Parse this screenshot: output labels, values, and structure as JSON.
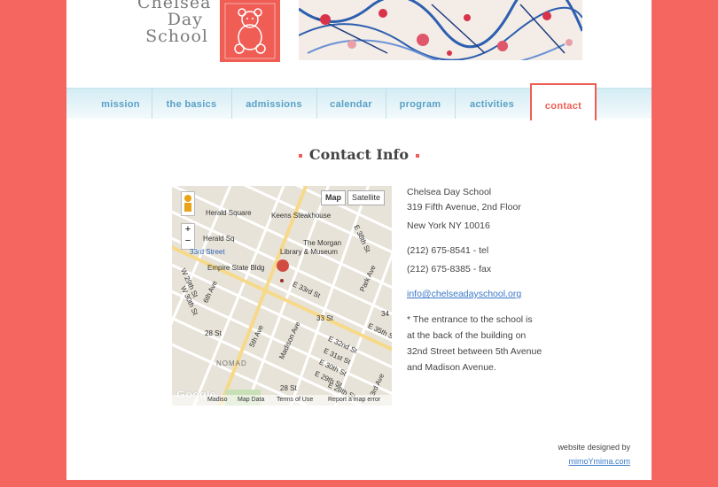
{
  "logo": {
    "line1": "Chelsea",
    "line2": "Day",
    "line3": "School"
  },
  "colors": {
    "accent": "#ef5d55",
    "nav_text": "#5aa0c6",
    "link": "#3a78c8",
    "background": "#f4665f"
  },
  "nav": {
    "items": [
      {
        "label": "mission"
      },
      {
        "label": "the basics"
      },
      {
        "label": "admissions"
      },
      {
        "label": "calendar"
      },
      {
        "label": "program"
      },
      {
        "label": "activities"
      },
      {
        "label": "contact",
        "active": true
      }
    ]
  },
  "page_title": "Contact Info",
  "map": {
    "map_button": "Map",
    "satellite_button": "Satellite",
    "zoom_in": "+",
    "zoom_out": "−",
    "labels": [
      "Herald Square",
      "Keens Steakhouse",
      "Herald Sq",
      "33rd Street",
      "The Morgan",
      "Library & Museum",
      "Empire State Bldg",
      "E 33rd St",
      "33 St",
      "28 St",
      "NOMAD",
      "28 St",
      "5th Ave",
      "Madison Ave",
      "Park Ave",
      "3rd Ave",
      "6th Ave",
      "W 29th St",
      "W 30th St",
      "E 38th St",
      "E 35th St",
      "E 32nd St",
      "E 31st St",
      "E 30th St",
      "E 29th St",
      "E 28th St",
      "34"
    ],
    "footer": {
      "data": "Map Data",
      "terms": "Terms of Use",
      "report": "Report a map error",
      "google": "Google",
      "street": "Madiso"
    }
  },
  "contact": {
    "name": "Chelsea Day School",
    "address1": "319 Fifth Avenue, 2nd Floor",
    "address2": "New York NY 10016",
    "tel": "(212) 675-8541 - tel",
    "fax": "(212) 675-8385 - fax",
    "email": "info@chelseadayschool.org",
    "note1": "* The entrance to the school is",
    "note2": "at the back of the building on",
    "note3": "32nd Street between 5th Avenue",
    "note4": "and Madison Avenue."
  },
  "credit": {
    "line": "website designed by",
    "link": "mimoYmima.com"
  }
}
